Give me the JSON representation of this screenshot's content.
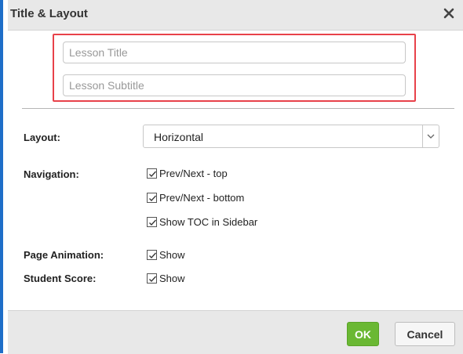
{
  "dialog": {
    "title": "Title & Layout",
    "close_icon": "close-icon"
  },
  "lesson": {
    "title_placeholder": "Lesson Title",
    "title_value": "",
    "subtitle_placeholder": "Lesson Subtitle",
    "subtitle_value": ""
  },
  "layout": {
    "label": "Layout:",
    "selected": "Horizontal"
  },
  "navigation": {
    "label": "Navigation:",
    "options": [
      {
        "label": "Prev/Next - top",
        "checked": true
      },
      {
        "label": "Prev/Next - bottom",
        "checked": true
      },
      {
        "label": "Show TOC in Sidebar",
        "checked": true
      }
    ]
  },
  "page_animation": {
    "label": "Page Animation:",
    "option": {
      "label": "Show",
      "checked": true
    }
  },
  "student_score": {
    "label": "Student Score:",
    "option": {
      "label": "Show",
      "checked": true
    }
  },
  "footer": {
    "ok_label": "OK",
    "cancel_label": "Cancel"
  },
  "colors": {
    "highlight": "#e8424a",
    "ok_button": "#6ab833",
    "accent": "#1e6ec8"
  }
}
